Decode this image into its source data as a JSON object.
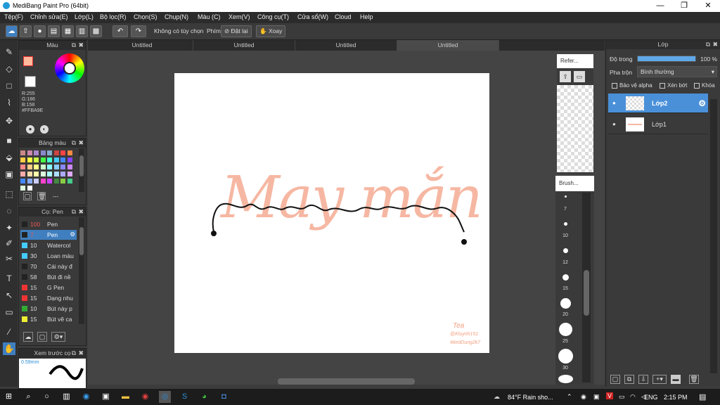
{
  "window": {
    "title": "MediBang Paint Pro (64bit)",
    "min": "—",
    "max": "❐",
    "close": "✕"
  },
  "menu": [
    "Tệp(F)",
    "Chỉnh sửa(E)",
    "Lớp(L)",
    "Bộ lọc(R)",
    "Chọn(S)",
    "Chụp(N)",
    "Màu (C)",
    "Xem(V)",
    "Công cụ(T)",
    "Cửa sổ(W)",
    "Cloud",
    "Help"
  ],
  "toolbar": {
    "no_option": "Không có tùy chọn",
    "keys": "Phím",
    "reset": "Đặt lại",
    "rotate": "Xoay"
  },
  "color_panel": {
    "title": "Màu",
    "r": "R:255",
    "g": "G:186",
    "b": "B:158",
    "hex": "#FFBA9E",
    "fg": "#FFBA9E"
  },
  "palette_panel": {
    "title": "Bảng màu",
    "dashes": "---",
    "swatches": [
      "#c88",
      "#c8a",
      "#a8c",
      "#88c",
      "#8ac",
      "#c44",
      "#f44",
      "#f84",
      "#fc4",
      "#ff4",
      "#cf4",
      "#4f4",
      "#4fc",
      "#4cf",
      "#48f",
      "#84f",
      "#f88",
      "#fc8",
      "#ff8",
      "#cfc",
      "#8ff",
      "#8cf",
      "#88f",
      "#c8f",
      "#faa",
      "#fda",
      "#ffa",
      "#dfd",
      "#aff",
      "#adf",
      "#aaf",
      "#daf",
      "#48f",
      "#8af",
      "#ccf",
      "#f4c",
      "#c4f",
      "#484",
      "#8c4",
      "#4c8",
      "#dfd",
      "#fff"
    ]
  },
  "brush_panel": {
    "title": "Cọ: Pen",
    "brushes": [
      {
        "size": "100",
        "name": "Pen",
        "color": "#222"
      },
      {
        "size": "7",
        "name": "Pen",
        "color": "#222"
      },
      {
        "size": "10",
        "name": "Watercol",
        "color": "#4cf"
      },
      {
        "size": "30",
        "name": "Loan màu",
        "color": "#4cf"
      },
      {
        "size": "70",
        "name": "Cái này đ",
        "color": "#222"
      },
      {
        "size": "58",
        "name": "Bút đi nề",
        "color": "#222"
      },
      {
        "size": "15",
        "name": "G Pen",
        "color": "#e33"
      },
      {
        "size": "15",
        "name": "Dạng nhu",
        "color": "#e33"
      },
      {
        "size": "10",
        "name": "Bút này p",
        "color": "#3a3"
      },
      {
        "size": "15",
        "name": "Bút vẽ ca",
        "color": "#ee3"
      }
    ]
  },
  "preview_panel": {
    "title": "Xem trước cọ",
    "size": "0.59mm"
  },
  "tabs": [
    "Untitled",
    "Untitled",
    "Untitled",
    "Untitled"
  ],
  "canvas": {
    "title_text": "May mắn",
    "script_text": "may mắn",
    "signature": "Tea",
    "sig2": "@Kluynh151",
    "sig3": "#tiedDung2k7"
  },
  "ref_panel": {
    "title": "Refer..."
  },
  "brush_size_panel": {
    "title": "Brush...",
    "sizes": [
      "7",
      "10",
      "12",
      "15",
      "20",
      "25",
      "30"
    ]
  },
  "layer_panel": {
    "title": "Lớp",
    "opacity_label": "Độ trong",
    "opacity_value": "100 %",
    "opacity": 1.0,
    "blend_label": "Pha trộn",
    "blend_value": "Bình thường",
    "protect_alpha": "Bảo vệ alpha",
    "clip": "Xén bớt",
    "lock": "Khóa",
    "layers": [
      {
        "name": "Lớp2"
      },
      {
        "name": "Lớp1"
      }
    ]
  },
  "taskbar": {
    "weather": "84°F Rain sho...",
    "lang": "ENG",
    "time": "2:15 PM"
  }
}
